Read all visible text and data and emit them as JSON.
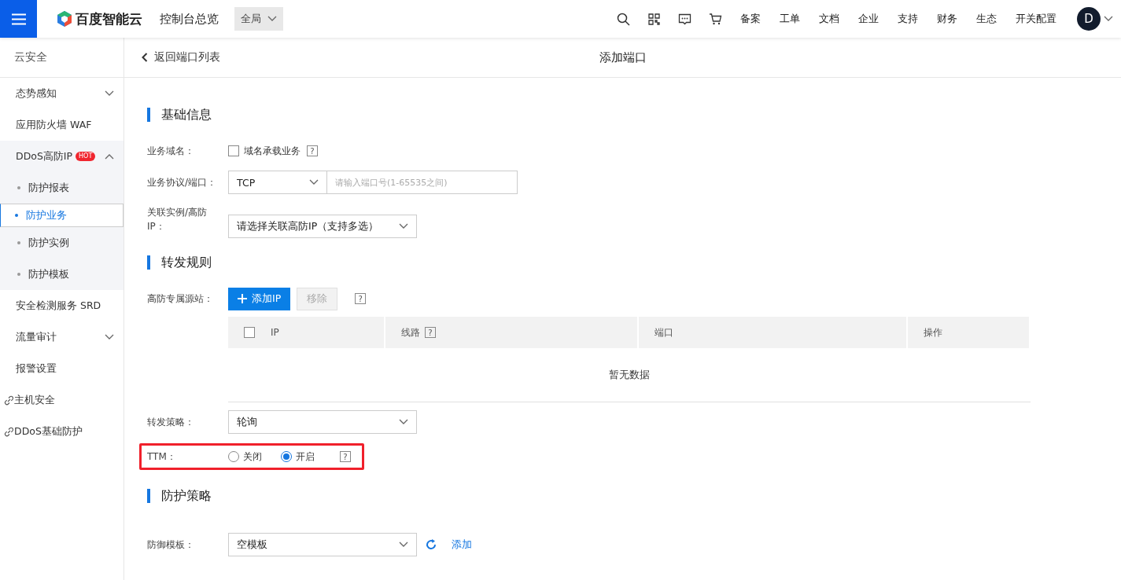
{
  "topbar": {
    "brand": "百度智能云",
    "console": "控制台总览",
    "region": "全局",
    "nav": [
      "备案",
      "工单",
      "文档",
      "企业",
      "支持",
      "财务",
      "生态",
      "开关配置"
    ],
    "avatar": "D"
  },
  "sidebar": {
    "title": "云安全",
    "items": [
      {
        "kind": "group",
        "label": "态势感知",
        "expanded": false
      },
      {
        "kind": "item",
        "label": "应用防火墙 WAF"
      },
      {
        "kind": "group",
        "label": "DDoS高防IP",
        "badge": "HOT",
        "expanded": true,
        "children": [
          {
            "label": "防护报表",
            "selected": false
          },
          {
            "label": "防护业务",
            "selected": true
          },
          {
            "label": "防护实例",
            "selected": false
          },
          {
            "label": "防护模板",
            "selected": false
          }
        ]
      },
      {
        "kind": "item",
        "label": "安全检测服务 SRD"
      },
      {
        "kind": "group",
        "label": "流量审计",
        "expanded": false
      },
      {
        "kind": "item",
        "label": "报警设置"
      },
      {
        "kind": "link",
        "label": "主机安全"
      },
      {
        "kind": "link",
        "label": "DDoS基础防护"
      }
    ]
  },
  "header": {
    "back": "返回端口列表",
    "title": "添加端口"
  },
  "sections": [
    {
      "title": "基础信息",
      "rows": [
        {
          "kind": "checkbox",
          "label": "业务域名：",
          "option": "域名承载业务",
          "checked": false,
          "help": "?"
        },
        {
          "kind": "protocol",
          "label": "业务协议/端口：",
          "value": "TCP",
          "placeholder": "请输入端口号(1-65535之间)"
        },
        {
          "kind": "select",
          "label": "关联实例/高防IP：",
          "value": "请选择关联高防IP（支持多选）"
        }
      ]
    },
    {
      "title": "转发规则",
      "rows": [
        {
          "kind": "table",
          "label": "高防专属源站：",
          "add_button": "添加IP",
          "remove_button": "移除",
          "help": "?",
          "select_all_checked": false,
          "columns": [
            {
              "label": "IP"
            },
            {
              "label": "线路",
              "help": "?"
            },
            {
              "label": "端口"
            },
            {
              "label": "操作"
            }
          ],
          "empty": "暂无数据"
        },
        {
          "kind": "select",
          "label": "转发策略：",
          "value": "轮询"
        },
        {
          "kind": "radio",
          "label": "TTM：",
          "highlighted": true,
          "help": "?",
          "options": [
            {
              "label": "关闭",
              "selected": false
            },
            {
              "label": "开启",
              "selected": true
            }
          ]
        }
      ]
    },
    {
      "title": "防护策略",
      "rows": [
        {
          "kind": "template",
          "label": "防御模板：",
          "value": "空模板",
          "link": "添加"
        }
      ]
    }
  ]
}
